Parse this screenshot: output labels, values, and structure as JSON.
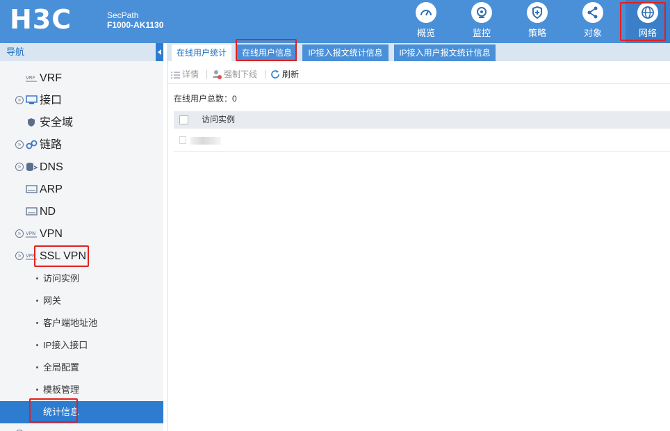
{
  "header": {
    "logo": "H3C",
    "product_line1": "SecPath",
    "product_line2": "F1000-AK1130",
    "nav": [
      {
        "label": "概览",
        "icon": "dashboard-icon"
      },
      {
        "label": "监控",
        "icon": "monitor-icon"
      },
      {
        "label": "策略",
        "icon": "shield-icon"
      },
      {
        "label": "对象",
        "icon": "share-icon"
      },
      {
        "label": "网络",
        "icon": "globe-icon",
        "active": true
      }
    ]
  },
  "sidebar": {
    "title": "导航",
    "items": [
      {
        "label": "VRF",
        "icon": "vrf-icon"
      },
      {
        "label": "接口",
        "icon": "interface-icon",
        "expandable": true
      },
      {
        "label": "安全域",
        "icon": "security-zone-icon"
      },
      {
        "label": "链路",
        "icon": "link-icon",
        "expandable": true
      },
      {
        "label": "DNS",
        "icon": "dns-icon",
        "expandable": true
      },
      {
        "label": "ARP",
        "icon": "arp-icon"
      },
      {
        "label": "ND",
        "icon": "nd-icon"
      },
      {
        "label": "VPN",
        "icon": "vpn-icon",
        "expandable": true
      },
      {
        "label": "SSL VPN",
        "icon": "ssl-vpn-icon",
        "expandable": true,
        "expanded": true
      }
    ],
    "sub_items": [
      {
        "label": "访问实例"
      },
      {
        "label": "网关"
      },
      {
        "label": "客户端地址池"
      },
      {
        "label": "IP接入接口"
      },
      {
        "label": "全局配置"
      },
      {
        "label": "模板管理"
      },
      {
        "label": "统计信息",
        "active": true
      }
    ]
  },
  "main": {
    "tabs": [
      {
        "label": "在线用户统计",
        "active": true
      },
      {
        "label": "在线用户信息"
      },
      {
        "label": "IP接入报文统计信息"
      },
      {
        "label": "IP接入用户报文统计信息"
      }
    ],
    "toolbar": {
      "details": "详情",
      "force_offline": "强制下线",
      "refresh": "刷新"
    },
    "total_label": "在线用户总数：0",
    "table": {
      "columns": [
        "访问实例"
      ]
    }
  },
  "colors": {
    "header_bg": "#4a90d9",
    "active_blue": "#2d7cd0",
    "highlight_red": "#e02020"
  }
}
